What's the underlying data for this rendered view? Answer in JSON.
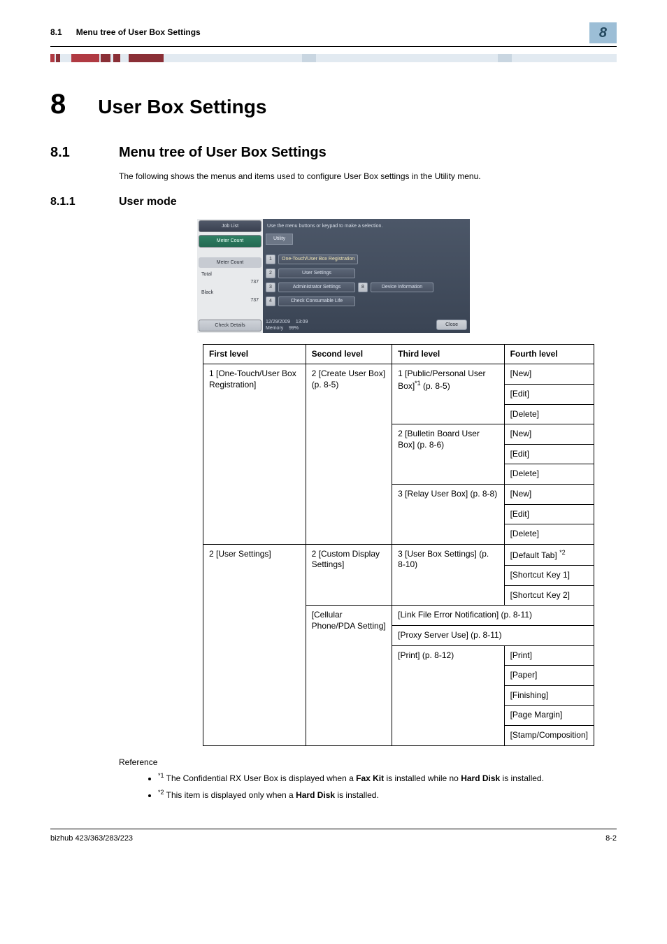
{
  "header": {
    "section_no": "8.1",
    "section_title": "Menu tree of User Box Settings",
    "badge": "8"
  },
  "chapter": {
    "num": "8",
    "title": "User Box Settings"
  },
  "h2": {
    "num": "8.1",
    "title": "Menu tree of User Box Settings"
  },
  "intro": "The following shows the menus and items used to configure User Box settings in the Utility menu.",
  "h3": {
    "num": "8.1.1",
    "title": "User mode"
  },
  "screenshot": {
    "left": {
      "tab_job": "Job List",
      "tab_meter": "Meter Count",
      "meter_label": "Meter Count",
      "total_label": "Total",
      "total_value": "737",
      "black_label": "Black",
      "black_value": "737",
      "check_details": "Check Details"
    },
    "topline": "Use the menu buttons or keypad to make a selection.",
    "crumb": "Utility",
    "items": [
      {
        "n": "1",
        "label": "One-Touch/User Box Registration",
        "highlighted": true
      },
      {
        "n": "2",
        "label": "User Settings"
      },
      {
        "n": "3",
        "label": "Administrator Settings",
        "pair_n": "8",
        "pair_label": "Device Information"
      },
      {
        "n": "4",
        "label": "Check Consumable Life"
      }
    ],
    "footer_date": "12/29/2009",
    "footer_time": "13:09",
    "footer_mem_label": "Memory",
    "footer_mem_value": "99%",
    "close": "Close"
  },
  "table": {
    "headers": [
      "First level",
      "Second level",
      "Third level",
      "Fourth level"
    ],
    "col1_r1": "1 [One-Touch/User Box Registration]",
    "col2_r1": "2 [Create User Box] (p. 8-5)",
    "col3_pp": "1 [Public/Personal User Box]",
    "col3_pp_sup": "*1",
    "col3_pp_pg": "(p. 8-5)",
    "col3_bb": "2 [Bulletin Board User Box] (p. 8-6)",
    "col3_relay": "3 [Relay User Box] (p. 8-8)",
    "fourth_new": "[New]",
    "fourth_edit": "[Edit]",
    "fourth_delete": "[Delete]",
    "col1_us": "2 [User Settings]",
    "col2_cds": "2 [Custom Display Settings]",
    "col3_ubs": "3 [User Box Settings] (p. 8-10)",
    "fourth_default_tab": "[Default Tab]",
    "fourth_default_tab_sup": "*2",
    "fourth_sc1": "[Shortcut Key 1]",
    "fourth_sc2": "[Shortcut Key 2]",
    "col2_cell": "[Cellular Phone/PDA Setting]",
    "col3_link": "[Link File Error Notification] (p. 8-11)",
    "col3_proxy": "[Proxy Server Use] (p. 8-11)",
    "col3_print": "[Print] (p. 8-12)",
    "fourth_print": "[Print]",
    "fourth_paper": "[Paper]",
    "fourth_finishing": "[Finishing]",
    "fourth_margin": "[Page Margin]",
    "fourth_stamp": "[Stamp/Composition]"
  },
  "reference": {
    "label": "Reference",
    "note1_sup": "*1",
    "note1_a": " The Confidential RX User Box is displayed when a ",
    "note1_b": "Fax Kit",
    "note1_c": " is installed while no ",
    "note1_d": "Hard Disk",
    "note1_e": " is installed.",
    "note2_sup": "*2",
    "note2_a": " This item is displayed only when a ",
    "note2_b": "Hard Disk",
    "note2_c": " is installed."
  },
  "footer": {
    "left": "bizhub 423/363/283/223",
    "right": "8-2"
  }
}
